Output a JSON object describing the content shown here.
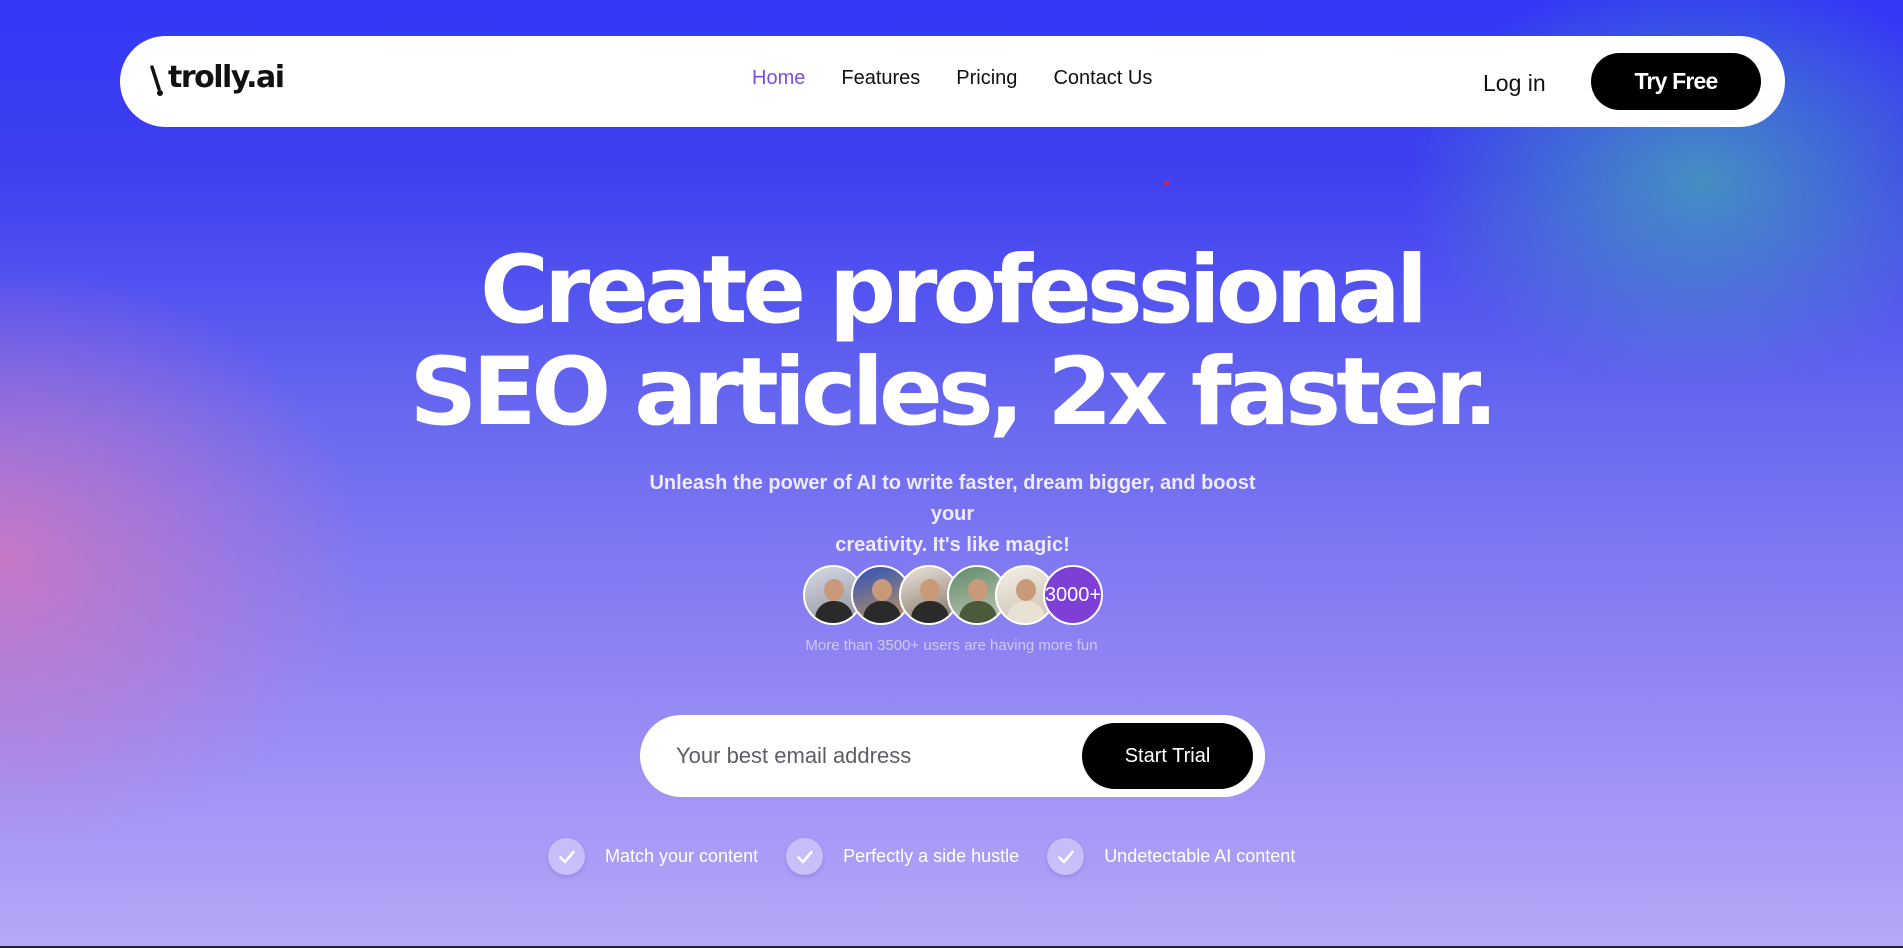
{
  "navbar": {
    "logo_text": "trolly.ai",
    "links": [
      {
        "label": "Home",
        "active": true
      },
      {
        "label": "Features",
        "active": false
      },
      {
        "label": "Pricing",
        "active": false
      },
      {
        "label": "Contact Us",
        "active": false
      }
    ],
    "login_label": "Log in",
    "cta_label": "Try Free"
  },
  "hero": {
    "title_line1": "Create professional",
    "title_line2": "SEO articles, 2x faster.",
    "subtitle_line1": "Unleash the power of AI to write faster, dream bigger, and boost your",
    "subtitle_line2": "creativity. It's like magic!",
    "avatar_count_badge": "3000+",
    "users_note": "More than 3500+ users are having more fun"
  },
  "signup": {
    "email_placeholder": "Your best email address",
    "email_value": "",
    "button_label": "Start Trial"
  },
  "features": [
    {
      "label": "Match your content",
      "icon": "check-icon"
    },
    {
      "label": "Perfectly a side hustle",
      "icon": "check-icon"
    },
    {
      "label": "Undetectable AI content",
      "icon": "check-icon"
    }
  ],
  "colors": {
    "accent": "#7a4de6",
    "cta_background": "#000000",
    "badge_background": "#7e3fd6"
  }
}
